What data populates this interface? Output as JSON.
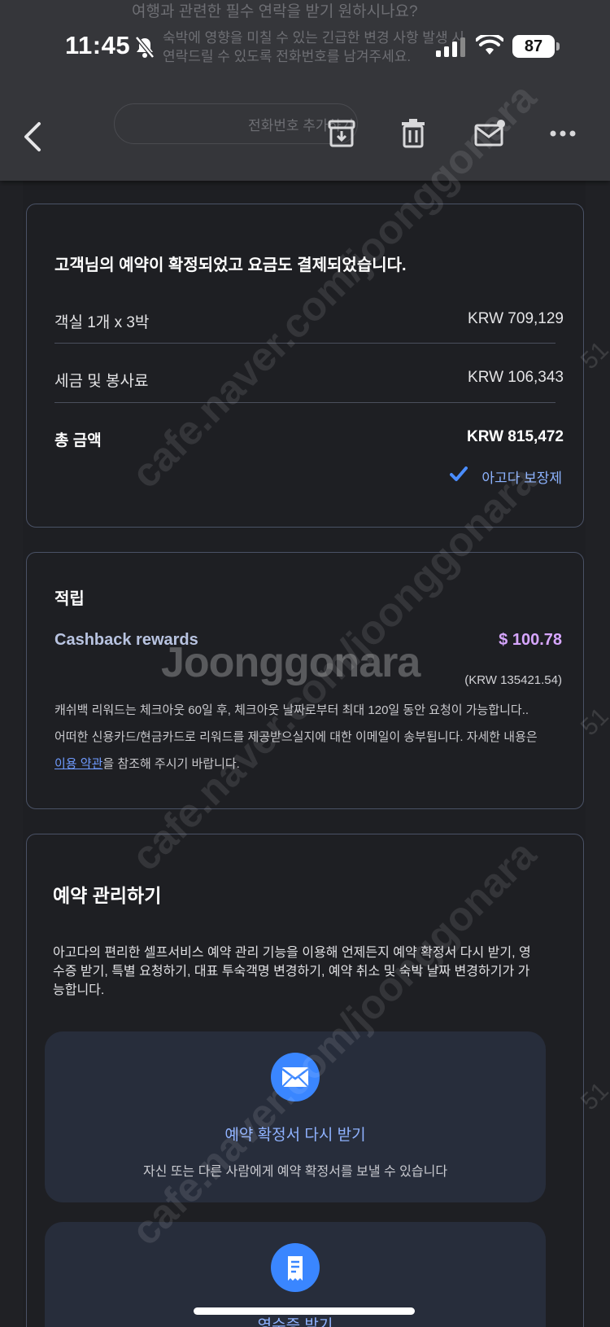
{
  "status_bar": {
    "time": "11:45",
    "battery": "87"
  },
  "background_email": {
    "line1": "여행과 관련한 필수 연락을 받기 원하시나요?",
    "line2": "숙박에 영향을 미칠 수 있는 긴급한 변경 사항 발생 시",
    "line3": "연락드릴 수 있도록 전화번호를 남겨주세요.",
    "button": "전화번호 추가하기"
  },
  "toolbar": {
    "icons": [
      "back-icon",
      "archive-icon",
      "trash-icon",
      "mail-icon",
      "more-icon"
    ]
  },
  "confirmation": {
    "title": "고객님의 예약이 확정되었고 요금도 결제되었습니다.",
    "rows": [
      {
        "label": "객실 1개 x 3박",
        "value": "KRW 709,129"
      },
      {
        "label": "세금 및 봉사료",
        "value": "KRW 106,343"
      },
      {
        "label": "총 금액",
        "value": "KRW 815,472"
      }
    ],
    "guarantee": "아고다 보장제"
  },
  "rewards": {
    "title": "적립",
    "label": "Cashback rewards",
    "value": "$ 100.78",
    "krw": "(KRW 135421.54)",
    "note1": "캐쉬백 리워드는 체크아웃 60일 후, 체크아웃 날짜로부터 최대 120일 동안 요청이 가능합니다..",
    "note2": "어떠한 신용카드/현금카드로 리워드를 제공받으실지에 대한 이메일이 송부됩니다. 자세한 내용은",
    "note3_link": "이용 약관",
    "note3_rest": "을 참조해 주시기 바랍니다."
  },
  "manage": {
    "title": "예약 관리하기",
    "desc": "아고다의 편리한 셀프서비스 예약 관리 기능을 이용해 언제든지 예약 확정서 다시 받기, 영수증 받기, 특별 요청하기, 대표 투숙객명 변경하기, 예약 취소 및 숙박 날짜 변경하기가 가능합니다.",
    "actions": [
      {
        "title": "예약 확정서 다시 받기",
        "desc": "자신 또는 다른 사람에게 예약 확정서를 보낼 수 있습니다",
        "icon": "envelope-icon"
      },
      {
        "title": "영수증 받기",
        "desc": "",
        "icon": "receipt-icon"
      }
    ]
  },
  "watermark": {
    "url": "cafe.naver.com/joonggonara",
    "brand": "Joonggonara",
    "side": "51"
  },
  "colors": {
    "accent": "#3a86ff",
    "link": "#8fb2ff",
    "cashback": "#d7a6ff",
    "card_border": "#4a5266"
  }
}
